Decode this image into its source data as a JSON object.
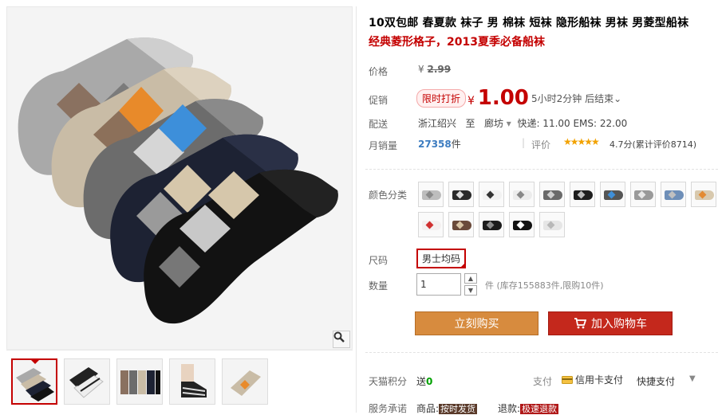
{
  "product": {
    "title": "10双包邮 春夏款 袜子 男 棉袜 短袜 隐形船袜 男袜 男菱型船袜",
    "subtitle": "经典菱形格子，2013夏季必备船袜"
  },
  "price": {
    "label": "价格",
    "currency": "¥",
    "original": "2.99"
  },
  "promotion": {
    "label": "促销",
    "tag": "限时打折",
    "currency": "¥",
    "price": "1.00",
    "countdown": "5小时2分钟 后结束",
    "countdown_arrow": "⌄"
  },
  "shipping": {
    "label": "配送",
    "from": "浙江绍兴",
    "to_word": "至",
    "to": "廊坊",
    "fees": "快递: 11.00 EMS: 22.00"
  },
  "sales": {
    "label": "月销量",
    "count": "27358",
    "unit": "件",
    "rating_label": "评价",
    "stars": "★★★★★",
    "rating_text": "4.7分(累计评价8714)"
  },
  "color": {
    "label": "颜色分类",
    "swatches": [
      {
        "sock": "#bdbdbd",
        "accent": "#8a8a8a"
      },
      {
        "sock": "#2a2a2a",
        "accent": "#dcdcdc"
      },
      {
        "sock": "#f2f2f2",
        "accent": "#333333"
      },
      {
        "sock": "#ececec",
        "accent": "#888888"
      },
      {
        "sock": "#6a6a6a",
        "accent": "#cfcfcf"
      },
      {
        "sock": "#1e1e1e",
        "accent": "#bcbcbc"
      },
      {
        "sock": "#555555",
        "accent": "#3f8fd8"
      },
      {
        "sock": "#9a9a9a",
        "accent": "#e8e8e8"
      },
      {
        "sock": "#6e8fb8",
        "accent": "#c0c0c0"
      },
      {
        "sock": "#d8c9ae",
        "accent": "#e38a32"
      },
      {
        "sock": "#f4f0f0",
        "accent": "#d03030"
      },
      {
        "sock": "#6a4a3a",
        "accent": "#d8c4a4"
      },
      {
        "sock": "#1c1c1c",
        "accent": "#8a8a8a"
      },
      {
        "sock": "#121212",
        "accent": "#ffffff"
      },
      {
        "sock": "#e6e6e6",
        "accent": "#b8b8b8"
      }
    ]
  },
  "size": {
    "label": "尺码",
    "selected": "男士均码"
  },
  "quantity": {
    "label": "数量",
    "value": "1",
    "unit": "件",
    "stock": "(库存155883件,限购10件)"
  },
  "actions": {
    "buy": "立刻购买",
    "cart": "加入购物车"
  },
  "points": {
    "label": "天猫积分",
    "prefix": "送",
    "value": "0"
  },
  "payment": {
    "label": "支付",
    "card": "信用卡支付",
    "quick": "快捷支付",
    "arrow": "▼"
  },
  "service": {
    "label": "服务承诺",
    "goods_label": "商品:",
    "goods_tag": "按时发货",
    "refund_label": "退款:",
    "refund_tag": "极速退款"
  }
}
